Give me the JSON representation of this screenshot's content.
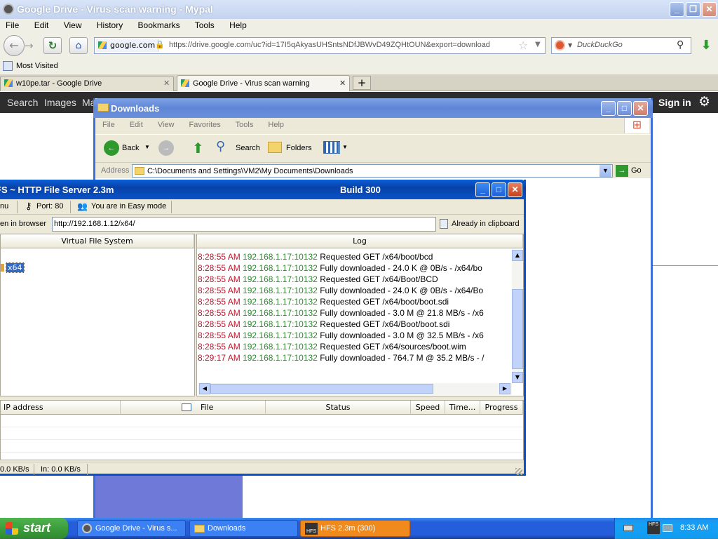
{
  "firefox": {
    "title": "Google Drive - Virus scan warning - Mypal",
    "menu": [
      "File",
      "Edit",
      "View",
      "History",
      "Bookmarks",
      "Tools",
      "Help"
    ],
    "site_label": "google.com",
    "url": "https://drive.google.com/uc?id=17I5qAkyasUHSntsNDfJBWvD49ZQHtOUN&export=download",
    "search_placeholder": "DuckDuckGo",
    "bookmark": "Most Visited",
    "tabs": [
      {
        "label": "w10pe.tar - Google Drive"
      },
      {
        "label": "Google Drive - Virus scan warning"
      }
    ],
    "page_bar": {
      "items": [
        "Search",
        "Images",
        "Ma"
      ],
      "signin": "Sign in"
    }
  },
  "explorer": {
    "title": "Downloads",
    "menu": [
      "File",
      "Edit",
      "View",
      "Favorites",
      "Tools",
      "Help"
    ],
    "back": "Back",
    "search": "Search",
    "folders": "Folders",
    "address_label": "Address",
    "address": "C:\\Documents and Settings\\VM2\\My Documents\\Downloads",
    "go": "Go"
  },
  "hfs": {
    "title": "FS ~ HTTP File Server 2.3m",
    "build": "Build 300",
    "menu_label": "nu",
    "port": "Port: 80",
    "mode": "You are in Easy mode",
    "open_browser": "en in browser",
    "url": "http://192.168.1.12/x64/",
    "clipboard": "Already in clipboard",
    "vfs_header": "Virtual File System",
    "vfs_item": "x64",
    "log_header": "Log",
    "log": [
      {
        "time": "8:28:55 AM",
        "ip": "192.168.1.17:10132",
        "msg": "Requested GET /x64/boot/bcd"
      },
      {
        "time": "8:28:55 AM",
        "ip": "192.168.1.17:10132",
        "msg": "Fully downloaded - 24.0 K @ 0B/s - /x64/bo"
      },
      {
        "time": "8:28:55 AM",
        "ip": "192.168.1.17:10132",
        "msg": "Requested GET /x64/Boot/BCD"
      },
      {
        "time": "8:28:55 AM",
        "ip": "192.168.1.17:10132",
        "msg": "Fully downloaded - 24.0 K @ 0B/s - /x64/Bo"
      },
      {
        "time": "8:28:55 AM",
        "ip": "192.168.1.17:10132",
        "msg": "Requested GET /x64/boot/boot.sdi"
      },
      {
        "time": "8:28:55 AM",
        "ip": "192.168.1.17:10132",
        "msg": "Fully downloaded - 3.0 M @ 21.8 MB/s - /x6"
      },
      {
        "time": "8:28:55 AM",
        "ip": "192.168.1.17:10132",
        "msg": "Requested GET /x64/Boot/boot.sdi"
      },
      {
        "time": "8:28:55 AM",
        "ip": "192.168.1.17:10132",
        "msg": "Fully downloaded - 3.0 M @ 32.5 MB/s - /x6"
      },
      {
        "time": "8:28:55 AM",
        "ip": "192.168.1.17:10132",
        "msg": "Requested GET /x64/sources/boot.wim"
      },
      {
        "time": "8:29:17 AM",
        "ip": "192.168.1.17:10132",
        "msg": "Fully downloaded - 764.7 M @ 35.2 MB/s - /"
      }
    ],
    "columns": [
      "IP address",
      "File",
      "Status",
      "Speed",
      "Time...",
      "Progress"
    ],
    "status_out": "0.0 KB/s",
    "status_in": "In: 0.0 KB/s"
  },
  "taskbar": {
    "start": "start",
    "items": [
      "Google Drive - Virus s...",
      "Downloads",
      "HFS 2.3m (300)"
    ],
    "tray_label": "HFS",
    "clock": "8:33 AM"
  }
}
